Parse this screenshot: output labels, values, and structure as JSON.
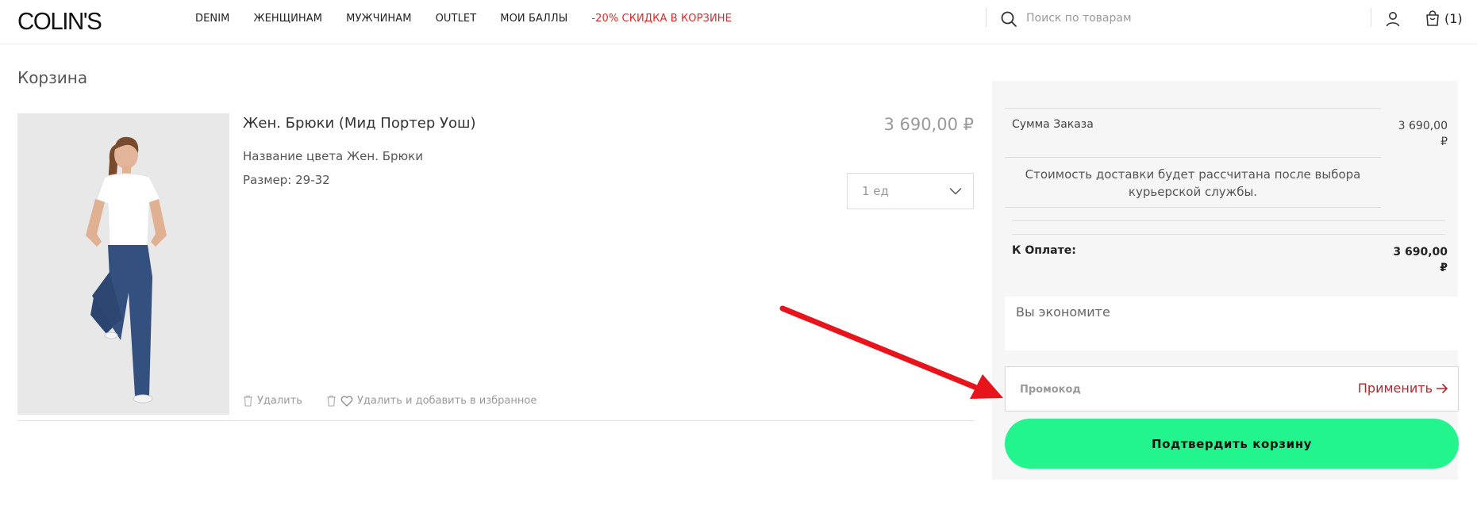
{
  "header": {
    "logo": "COLIN'S",
    "nav": [
      "DENIM",
      "ЖЕНЩИНАМ",
      "МУЖЧИНАМ",
      "OUTLET",
      "МОИ БАЛЛЫ"
    ],
    "sale_link": "-20% СКИДКА В КОРЗИНЕ",
    "search_placeholder": "Поиск по товарам",
    "cart_count": "(1)",
    "icons": [
      "search-icon",
      "user-icon",
      "cart-icon"
    ]
  },
  "page": {
    "title": "Корзина"
  },
  "item": {
    "name": "Жен. Брюки (Мид Портер Уош)",
    "price": "3 690,00 ₽",
    "color": "Название цвета Жен. Брюки",
    "size": "Размер: 29-32",
    "quantity": "1 ед",
    "remove_label": "Удалить",
    "remove_fav_label": "Удалить и добавить в избранное"
  },
  "summary": {
    "order_sum_label": "Сумма Заказа",
    "order_sum_value_line1": "3 690,00",
    "order_sum_value_line2": "₽",
    "delivery_note": "Стоимость доставки будет рассчитана после выбора курьерской службы.",
    "pay_label": "К Оплате:",
    "pay_value_line1": "3 690,00",
    "pay_value_line2": "₽",
    "savings_label": "Вы экономите",
    "promo_placeholder": "Промокод",
    "apply_label": "Применить",
    "confirm_label": "Подтвердить корзину"
  },
  "colors": {
    "sale": "#e3262a",
    "confirm_button": "#23f58e",
    "apply_link": "#b0282c",
    "annotation_arrow": "#e8141b",
    "panel_bg": "#f6f6f7"
  }
}
